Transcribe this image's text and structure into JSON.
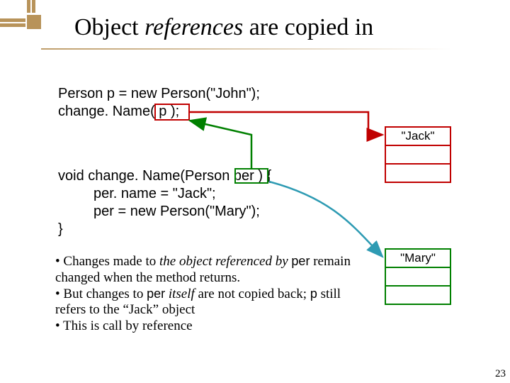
{
  "title": {
    "t1": "Object ",
    "t2": "references",
    "t3": " are copied in"
  },
  "code1": {
    "line1": "Person p = new Person(\"John\");",
    "line2a": "change. Name(   ",
    "line2b": "p",
    "line2c": "   );"
  },
  "code2": {
    "l1a": "void change. Name(Person  ",
    "l1b": "per",
    "l1c": " ) {",
    "l2": "per. name = \"Jack\";",
    "l3": "per = new Person(\"Mary\");",
    "l4": "}"
  },
  "jack_obj": {
    "cell1": "\"Jack\"",
    "cell2": "",
    "cell3": ""
  },
  "mary_obj": {
    "cell1": "\"Mary\"",
    "cell2": "",
    "cell3": ""
  },
  "bullets": {
    "b1a": "• Changes made to ",
    "b1b": "the object referenced by ",
    "b1c": "per",
    "b1d": " remain changed when the method returns.",
    "b2a": "• But changes to ",
    "b2b": "per",
    "b2c": " itself",
    "b2d": " are not copied back; ",
    "b2e": "p",
    "b2f": " still refers to the “Jack” object",
    "b3a": "• This is ",
    "b3b": "call by reference"
  },
  "pagenum": "23"
}
